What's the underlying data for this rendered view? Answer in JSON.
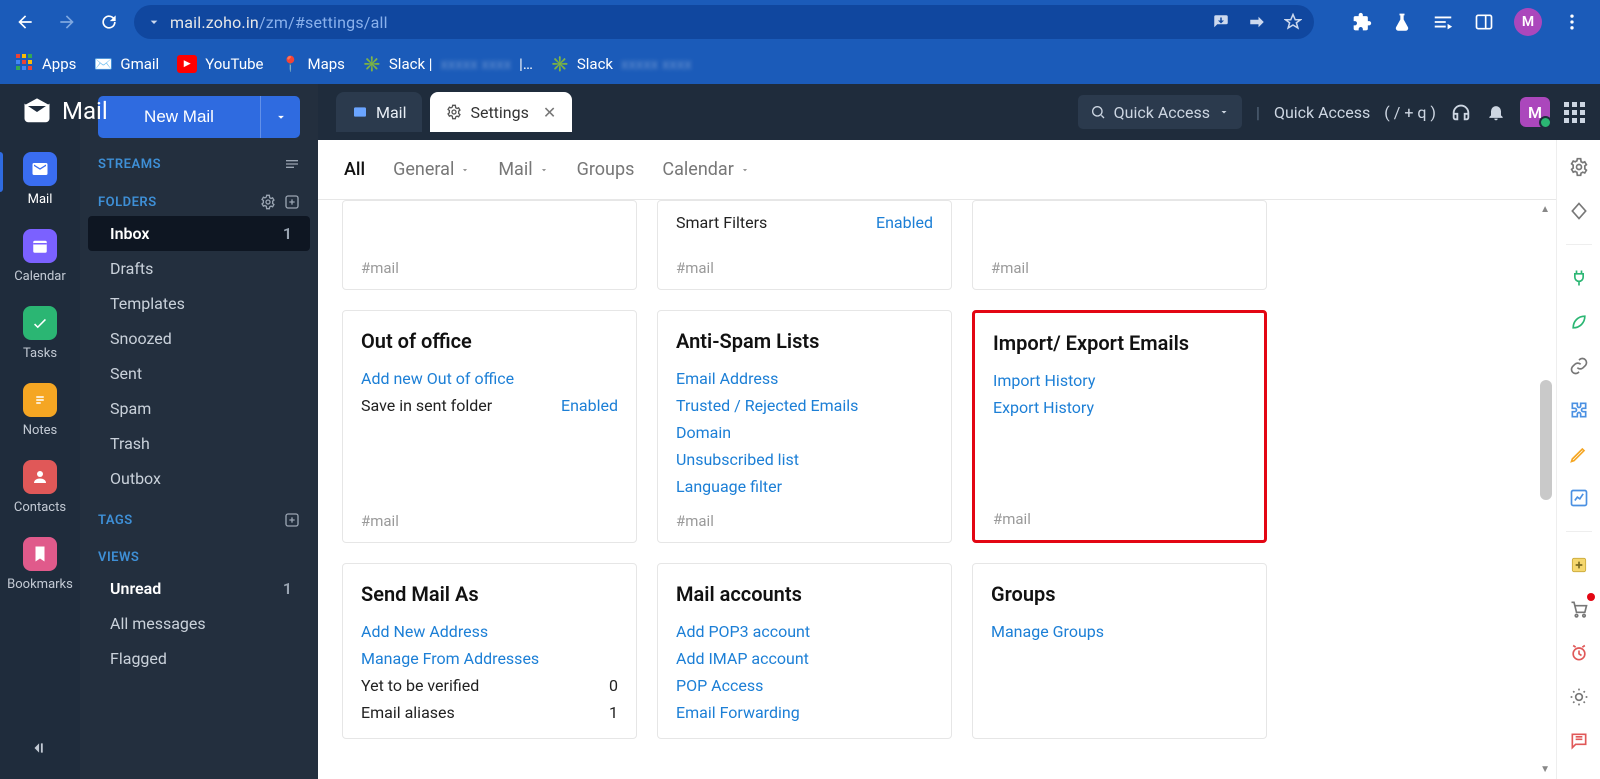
{
  "browser": {
    "url_host": "mail.zoho.in",
    "url_path": "/zm/#settings/all",
    "bookmarks": {
      "apps": "Apps",
      "gmail": "Gmail",
      "youtube": "YouTube",
      "maps": "Maps",
      "slack1": "Slack |",
      "slack1_blur": "xxxxx xxxx",
      "slack1_sep": "|…",
      "slack2": "Slack",
      "slack2_blur": "xxxxx xxxx"
    },
    "avatar_letter": "M"
  },
  "app": {
    "title": "Mail",
    "rail": {
      "mail": "Mail",
      "calendar": "Calendar",
      "tasks": "Tasks",
      "notes": "Notes",
      "contacts": "Contacts",
      "bookmarks": "Bookmarks"
    },
    "newmail": "New Mail",
    "sections": {
      "streams": "STREAMS",
      "folders": "FOLDERS",
      "tags": "TAGS",
      "views": "VIEWS"
    },
    "folders": {
      "inbox": "Inbox",
      "inbox_count": "1",
      "drafts": "Drafts",
      "templates": "Templates",
      "snoozed": "Snoozed",
      "sent": "Sent",
      "spam": "Spam",
      "trash": "Trash",
      "outbox": "Outbox"
    },
    "views": {
      "unread": "Unread",
      "unread_count": "1",
      "all": "All messages",
      "flagged": "Flagged"
    },
    "tabs": {
      "mail": "Mail",
      "settings": "Settings"
    },
    "topbar": {
      "quick_access_btn": "Quick Access",
      "quick_access_label": "Quick Access",
      "quick_access_hint": "( / + q )"
    },
    "avatar_letter": "M"
  },
  "settings": {
    "subtabs": {
      "all": "All",
      "general": "General",
      "mail": "Mail",
      "groups": "Groups",
      "calendar": "Calendar"
    },
    "hashmail": "#mail",
    "smartfilters": {
      "label": "Smart Filters",
      "status": "Enabled"
    },
    "ooo": {
      "title": "Out of office",
      "addnew": "Add new Out of office",
      "save_label": "Save in sent folder",
      "save_status": "Enabled"
    },
    "antispam": {
      "title": "Anti-Spam Lists",
      "email": "Email Address",
      "trusted": "Trusted / Rejected Emails",
      "domain": "Domain",
      "unsub": "Unsubscribed list",
      "lang": "Language filter"
    },
    "impexp": {
      "title": "Import/ Export Emails",
      "import": "Import History",
      "export": "Export History"
    },
    "sendas": {
      "title": "Send Mail As",
      "addnew": "Add New Address",
      "manage": "Manage From Addresses",
      "yet_label": "Yet to be verified",
      "yet_val": "0",
      "alias_label": "Email aliases",
      "alias_val": "1"
    },
    "accounts": {
      "title": "Mail accounts",
      "pop3": "Add POP3 account",
      "imap": "Add IMAP account",
      "pop": "POP Access",
      "fwd": "Email Forwarding"
    },
    "groups": {
      "title": "Groups",
      "manage": "Manage Groups"
    }
  }
}
